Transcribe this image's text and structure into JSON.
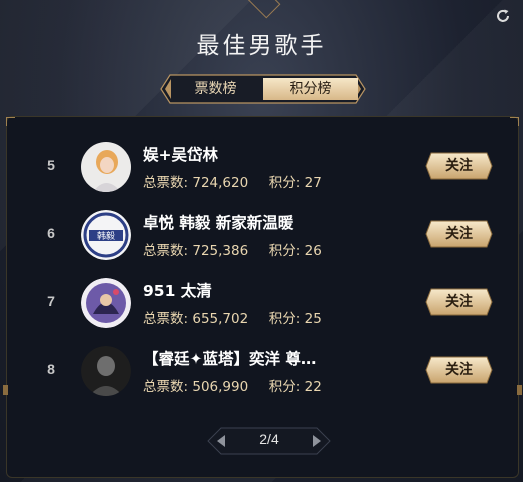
{
  "header": {
    "title": "最佳男歌手"
  },
  "tabs": [
    {
      "label": "票数榜",
      "active": false
    },
    {
      "label": "积分榜",
      "active": true
    }
  ],
  "list": {
    "votes_label": "总票数:",
    "points_label": "积分:",
    "follow_label": "关注",
    "items": [
      {
        "rank": "5",
        "name": "娱+吴岱林",
        "votes": "724,620",
        "points": "27"
      },
      {
        "rank": "6",
        "name": "卓悦 韩毅 新家新温暖",
        "votes": "725,386",
        "points": "26",
        "avatar_text": "韩毅"
      },
      {
        "rank": "7",
        "name": "951 太清",
        "votes": "655,702",
        "points": "25"
      },
      {
        "rank": "8",
        "name": "【睿廷✦蓝塔】奕洋 尊…",
        "votes": "506,990",
        "points": "22"
      }
    ]
  },
  "pagination": {
    "label": "2/4"
  },
  "icons": {
    "refresh": "refresh-icon",
    "prev": "chevron-left-icon",
    "next": "chevron-right-icon"
  },
  "colors": {
    "gold_text": "#e9d6b0",
    "button_gold": "#d8b889",
    "panel_bg": "#11151f"
  }
}
